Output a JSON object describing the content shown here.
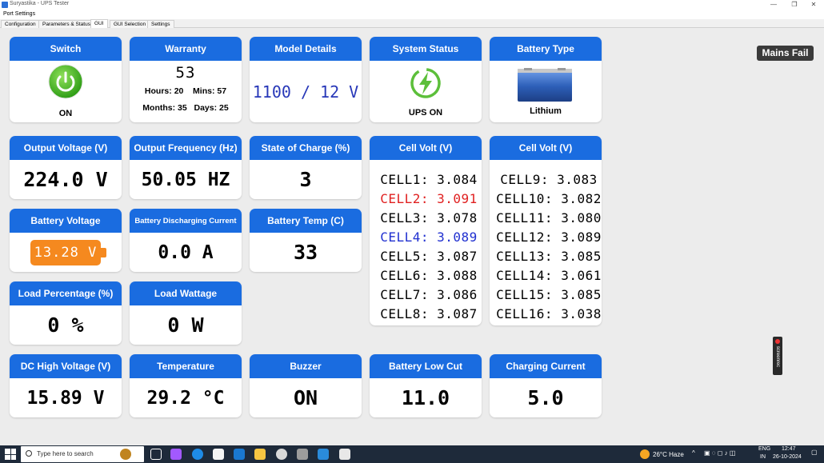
{
  "window": {
    "title": "Suryastika - UPS Tester",
    "minimize": "—",
    "restore": "❐",
    "close": "✕"
  },
  "menu": {
    "port_settings": "Port Settings"
  },
  "tabs": [
    "Configuration",
    "Parameters & Status",
    "GUI",
    "GUI Selection",
    "Settings"
  ],
  "active_tab": "GUI",
  "cards": {
    "switch": {
      "title": "Switch",
      "state": "ON",
      "icon_color": "#4fbf26"
    },
    "warranty": {
      "title": "Warranty",
      "value": "53",
      "hours_label": "Hours:",
      "hours": "20",
      "mins_label": "Mins:",
      "mins": "57",
      "months_label": "Months:",
      "months": "35",
      "days_label": "Days:",
      "days": "25"
    },
    "model": {
      "title": "Model Details",
      "value": "1100 / 12 V"
    },
    "system_status": {
      "title": "System Status",
      "value": "UPS ON"
    },
    "battery_type": {
      "title": "Battery Type",
      "value": "Lithium"
    },
    "output_voltage": {
      "title": "Output Voltage (V)",
      "value": "224.0 V"
    },
    "output_frequency": {
      "title": "Output Frequency (Hz)",
      "value": "50.05 HZ"
    },
    "soc": {
      "title": "State of Charge (%)",
      "value": "3"
    },
    "cell_volt_1": {
      "title": "Cell Volt (V)",
      "cells": [
        {
          "text": "CELL1: 3.084",
          "color": "#000000"
        },
        {
          "text": "CELL2: 3.091",
          "color": "#e02020"
        },
        {
          "text": "CELL3: 3.078",
          "color": "#000000"
        },
        {
          "text": "CELL4: 3.089",
          "color": "#2030d0"
        },
        {
          "text": "CELL5: 3.087",
          "color": "#000000"
        },
        {
          "text": "CELL6: 3.088",
          "color": "#000000"
        },
        {
          "text": "CELL7: 3.086",
          "color": "#000000"
        },
        {
          "text": "CELL8: 3.087",
          "color": "#000000"
        }
      ]
    },
    "cell_volt_2": {
      "title": "Cell Volt (V)",
      "cells": [
        {
          "text": "CELL9: 3.083",
          "color": "#000000"
        },
        {
          "text": "CELL10: 3.082",
          "color": "#000000"
        },
        {
          "text": "CELL11: 3.080",
          "color": "#000000"
        },
        {
          "text": "CELL12: 3.089",
          "color": "#000000"
        },
        {
          "text": "CELL13: 3.085",
          "color": "#000000"
        },
        {
          "text": "CELL14: 3.061",
          "color": "#000000"
        },
        {
          "text": "CELL15: 3.085",
          "color": "#000000"
        },
        {
          "text": "CELL16: 3.038",
          "color": "#000000"
        }
      ]
    },
    "battery_voltage": {
      "title": "Battery Voltage",
      "value": "13.28 V",
      "badge_color": "#f5891f"
    },
    "discharging_current": {
      "title": "Battery Discharging Current",
      "value": "0.0 A"
    },
    "battery_temp": {
      "title": "Battery Temp (C)",
      "value": "33"
    },
    "load_percentage": {
      "title": "Load Percentage (%)",
      "value": "0 %"
    },
    "load_wattage": {
      "title": "Load Wattage",
      "value": "0 W"
    },
    "dc_high_voltage": {
      "title": "DC High Voltage (V)",
      "value": "15.89 V"
    },
    "temperature": {
      "title": "Temperature",
      "value": "29.2 °C"
    },
    "buzzer": {
      "title": "Buzzer",
      "value": "ON"
    },
    "battery_low_cut": {
      "title": "Battery Low Cut",
      "value": "11.0"
    },
    "charging_current": {
      "title": "Charging Current",
      "value": "5.0"
    }
  },
  "mains_status": "Mains Fail",
  "recorder": "screenrec",
  "taskbar": {
    "search_placeholder": "Type here to search",
    "weather": "26°C  Haze",
    "lang": "ENG",
    "region": "IN",
    "time": "12:47",
    "date": "26-10-2024"
  },
  "colors": {
    "header_blue": "#1a6ce0",
    "background": "#ececec"
  }
}
